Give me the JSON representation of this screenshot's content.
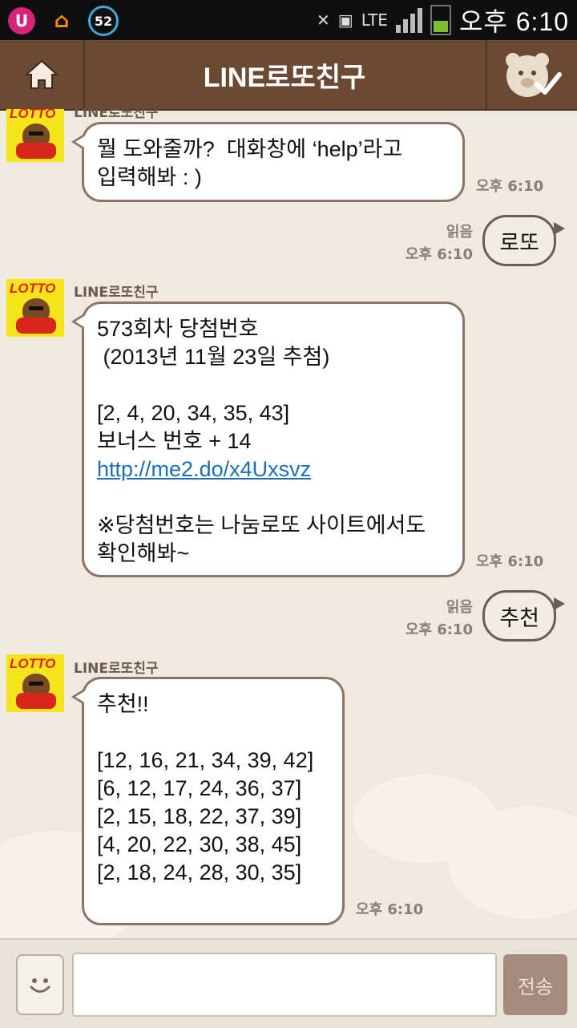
{
  "status_bar": {
    "notification_badge": "52",
    "network": "LTE",
    "time": "오후 6:10"
  },
  "header": {
    "title": "LINE로또친구"
  },
  "messages": [
    {
      "sender": "LINE로또친구",
      "text": "뭘 도와줄까?  대화창에 ‘help’라고\n입력해봐 : )",
      "time": "오후 6:10"
    },
    {
      "read": "읽음",
      "text": "로또",
      "time": "오후 6:10"
    },
    {
      "sender": "LINE로또친구",
      "text_before_link": "573회차 당첨번호\n (2013년 11월 23일 추첨)\n\n[2, 4, 20, 34, 35, 43]\n보너스 번호 + 14\n",
      "link": "http://me2.do/x4Uxsvz",
      "text_after_link": "\n\n※당첨번호는 나눔로또 사이트에서도\n확인해봐~",
      "time": "오후 6:10"
    },
    {
      "read": "읽음",
      "text": "추천",
      "time": "오후 6:10"
    },
    {
      "sender": "LINE로또친구",
      "text": "추천!!\n\n[12, 16, 21, 34, 39, 42]\n[6, 12, 17, 24, 36, 37]\n[2, 15, 18, 22, 37, 39]\n[4, 20, 22, 30, 38, 45]\n[2, 18, 24, 28, 30, 35]\n",
      "time": "오후 6:10"
    }
  ],
  "avatar": {
    "label": "LOTTO"
  },
  "input_bar": {
    "placeholder": "",
    "send_label": "전송"
  },
  "colors": {
    "header": "#6b4a33",
    "chat_background": "#efe9df",
    "bubble_border": "#8c7566",
    "link": "#1a6fb5"
  }
}
